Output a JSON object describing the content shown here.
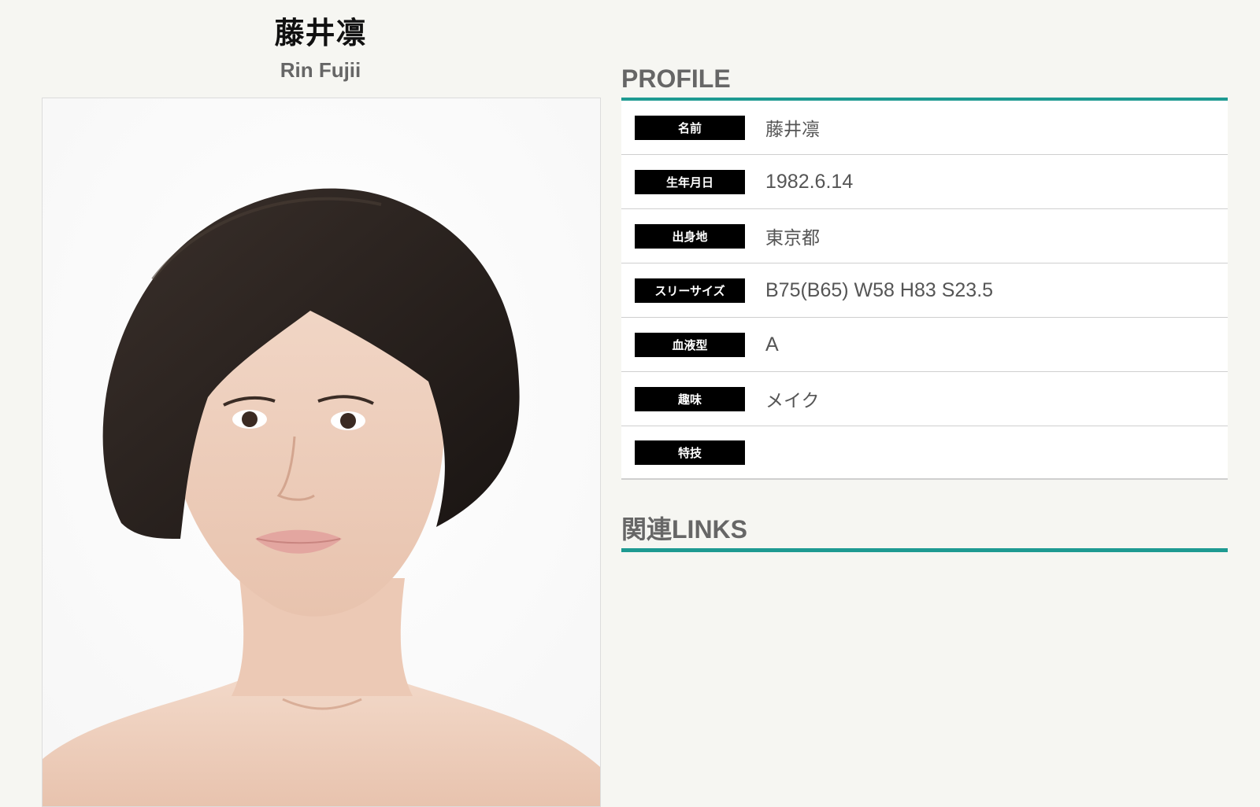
{
  "header": {
    "name_jp": "藤井凛",
    "name_en": "Rin Fujii"
  },
  "photo": {
    "icon": "portrait-photo"
  },
  "profile": {
    "title": "PROFILE",
    "accent_color": "#1e9a92",
    "rows": [
      {
        "label": "名前",
        "value": "藤井凛"
      },
      {
        "label": "生年月日",
        "value": "1982.6.14"
      },
      {
        "label": "出身地",
        "value": "東京都"
      },
      {
        "label": "スリーサイズ",
        "value": "B75(B65) W58 H83 S23.5"
      },
      {
        "label": "血液型",
        "value": "A"
      },
      {
        "label": "趣味",
        "value": "メイク"
      },
      {
        "label": "特技",
        "value": ""
      }
    ]
  },
  "links": {
    "title": "関連LINKS"
  }
}
